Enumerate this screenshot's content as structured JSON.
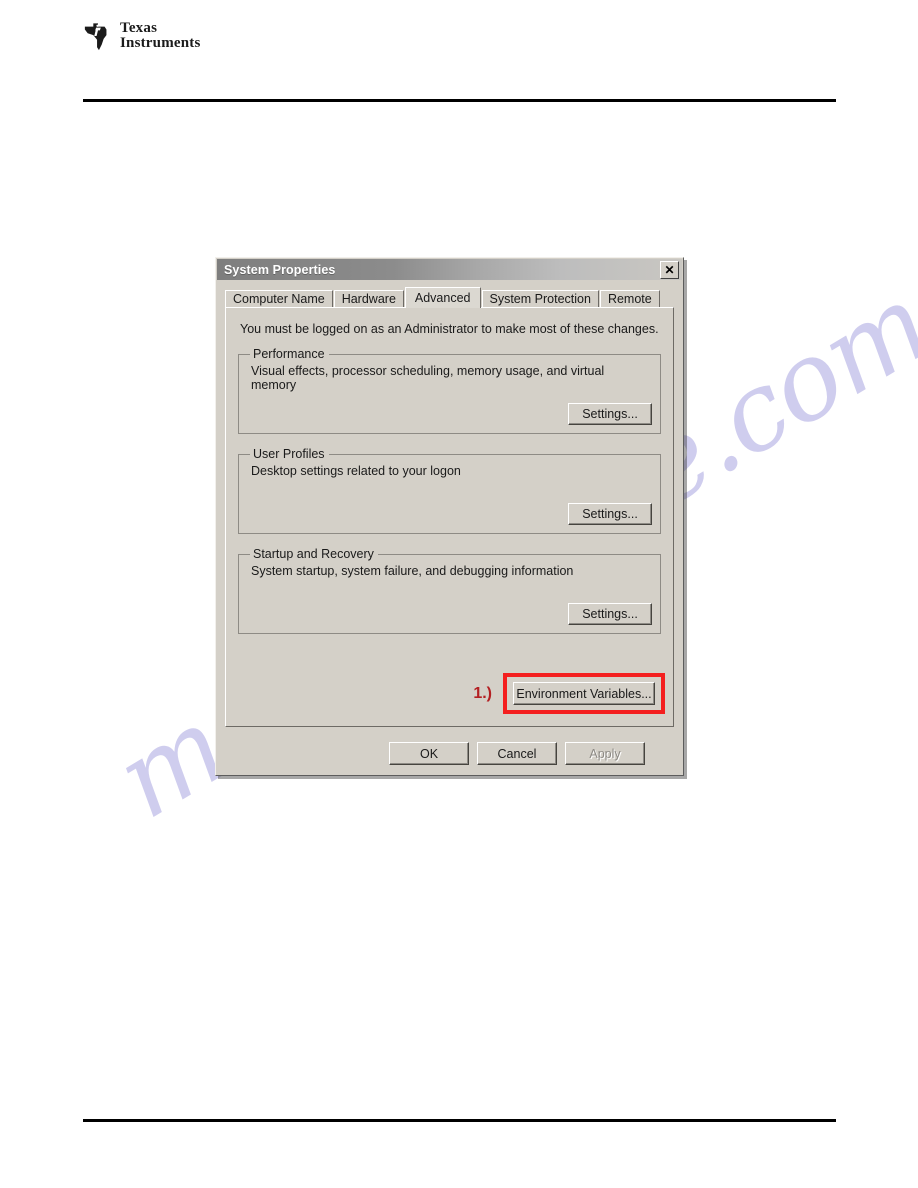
{
  "page": {
    "logo": {
      "line1": "Texas",
      "line2": "Instruments",
      "mark_name": "ti-texas-state-logo"
    }
  },
  "watermark": {
    "text": "manualshive.com",
    "color": "#b3b0e4"
  },
  "dialog": {
    "title": "System Properties",
    "close_label": "✕",
    "tabs": [
      {
        "label": "Computer Name",
        "active": false
      },
      {
        "label": "Hardware",
        "active": false
      },
      {
        "label": "Advanced",
        "active": true
      },
      {
        "label": "System Protection",
        "active": false
      },
      {
        "label": "Remote",
        "active": false
      }
    ],
    "admin_note": "You must be logged on as an Administrator to make most of these changes.",
    "groups": [
      {
        "legend": "Performance",
        "description": "Visual effects, processor scheduling, memory usage, and virtual memory",
        "button": "Settings..."
      },
      {
        "legend": "User Profiles",
        "description": "Desktop settings related to your logon",
        "button": "Settings..."
      },
      {
        "legend": "Startup and Recovery",
        "description": "System startup, system failure, and debugging information",
        "button": "Settings..."
      }
    ],
    "environment_variables": {
      "step_label": "1.)",
      "button": "Environment Variables...",
      "highlight_color": "#f41f1f",
      "step_color": "#b41f22"
    },
    "footer_buttons": [
      {
        "label": "OK",
        "disabled": false
      },
      {
        "label": "Cancel",
        "disabled": false
      },
      {
        "label": "Apply",
        "disabled": true
      }
    ]
  }
}
